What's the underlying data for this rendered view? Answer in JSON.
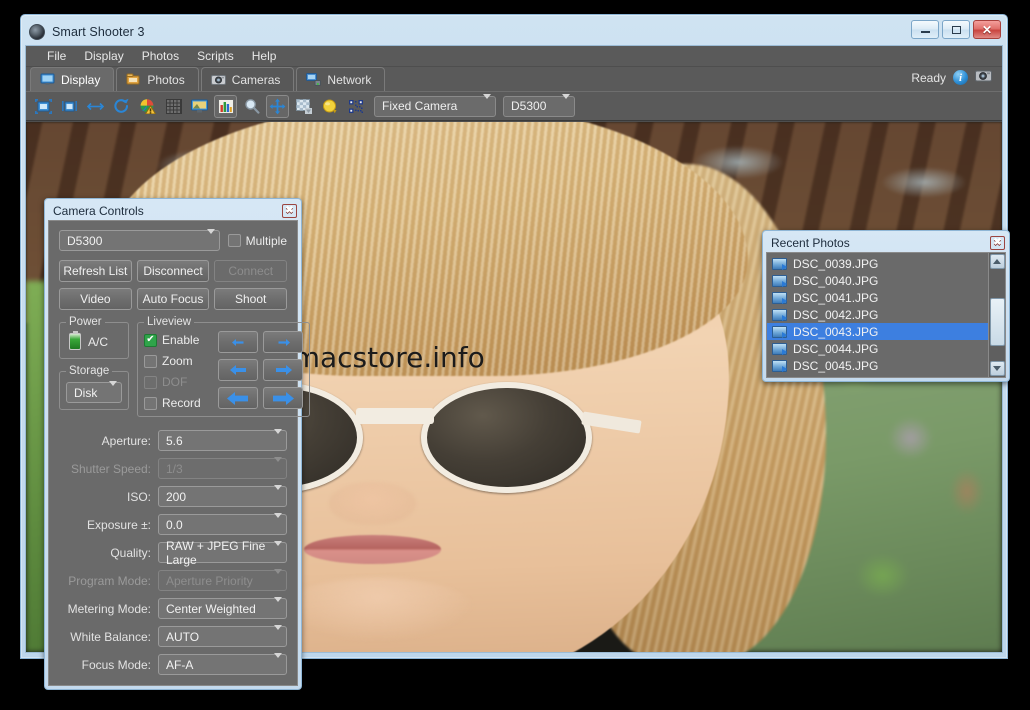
{
  "window": {
    "title": "Smart Shooter 3",
    "app_icon": "camera-lens-icon",
    "minimize_label": "Minimize",
    "maximize_label": "Maximize",
    "close_label": "Close"
  },
  "menubar": {
    "items": [
      {
        "label": "File"
      },
      {
        "label": "Display"
      },
      {
        "label": "Photos"
      },
      {
        "label": "Scripts"
      },
      {
        "label": "Help"
      }
    ]
  },
  "tabs": [
    {
      "label": "Display",
      "icon": "monitor-icon",
      "active": true
    },
    {
      "label": "Photos",
      "icon": "folder-image-icon",
      "active": false
    },
    {
      "label": "Cameras",
      "icon": "camera-icon",
      "active": false
    },
    {
      "label": "Network",
      "icon": "network-icon",
      "active": false
    }
  ],
  "status": {
    "text": "Ready",
    "info_icon": "info-icon",
    "info_glyph": "i",
    "camera_icon": "camera-status-icon"
  },
  "toolbar": {
    "buttons": [
      {
        "name": "fit-to-window-icon"
      },
      {
        "name": "actual-size-icon"
      },
      {
        "name": "fit-width-icon"
      },
      {
        "name": "refresh-icon"
      },
      {
        "name": "color-warning-icon"
      },
      {
        "name": "grid-icon"
      },
      {
        "name": "screen-overlay-icon"
      },
      {
        "name": "histogram-icon",
        "pressed": true
      },
      {
        "name": "magnifier-icon"
      },
      {
        "name": "move-tool-icon",
        "pressed": true
      },
      {
        "name": "transparency-icon"
      },
      {
        "name": "highlight-icon"
      },
      {
        "name": "qr-code-icon"
      }
    ],
    "camera_mode": {
      "value": "Fixed Camera",
      "caret": "chevron-down-icon"
    },
    "camera_model": {
      "value": "D5300",
      "caret": "chevron-down-icon"
    }
  },
  "viewport": {
    "watermark": "精品Mac软件尽在macstore.info"
  },
  "camera_controls": {
    "title": "Camera Controls",
    "close_glyph": "✖",
    "camera_select": {
      "value": "D5300"
    },
    "multiple": {
      "label": "Multiple",
      "checked": false
    },
    "buttons_row1": [
      {
        "label": "Refresh List",
        "disabled": false
      },
      {
        "label": "Disconnect",
        "disabled": false
      },
      {
        "label": "Connect",
        "disabled": true
      }
    ],
    "buttons_row2": [
      {
        "label": "Video",
        "disabled": false
      },
      {
        "label": "Auto Focus",
        "disabled": false
      },
      {
        "label": "Shoot",
        "disabled": false
      }
    ],
    "power": {
      "legend": "Power",
      "value": "A/C",
      "icon": "battery-icon"
    },
    "storage": {
      "legend": "Storage",
      "value": "Disk"
    },
    "liveview": {
      "legend": "Liveview",
      "checks": [
        {
          "label": "Enable",
          "checked": true,
          "disabled": false
        },
        {
          "label": "Zoom",
          "checked": false,
          "disabled": false
        },
        {
          "label": "DOF",
          "checked": false,
          "disabled": true
        },
        {
          "label": "Record",
          "checked": false,
          "disabled": false
        }
      ],
      "arrow_buttons": [
        {
          "name": "left-arrow-small",
          "dir": "left",
          "size": "small"
        },
        {
          "name": "right-arrow-small",
          "dir": "right",
          "size": "small"
        },
        {
          "name": "left-arrow-medium",
          "dir": "left",
          "size": "medium"
        },
        {
          "name": "right-arrow-medium",
          "dir": "right",
          "size": "medium"
        },
        {
          "name": "left-arrow-large",
          "dir": "left",
          "size": "large"
        },
        {
          "name": "right-arrow-large",
          "dir": "right",
          "size": "large"
        }
      ]
    },
    "params": [
      {
        "label": "Aperture:",
        "value": "5.6",
        "disabled": false
      },
      {
        "label": "Shutter Speed:",
        "value": "1/3",
        "disabled": true
      },
      {
        "label": "ISO:",
        "value": "200",
        "disabled": false
      },
      {
        "label": "Exposure ±:",
        "value": "0.0",
        "disabled": false
      },
      {
        "label": "Quality:",
        "value": "RAW + JPEG Fine Large",
        "disabled": false
      },
      {
        "label": "Program Mode:",
        "value": "Aperture Priority",
        "disabled": true
      },
      {
        "label": "Metering Mode:",
        "value": "Center Weighted",
        "disabled": false
      },
      {
        "label": "White Balance:",
        "value": "AUTO",
        "disabled": false
      },
      {
        "label": "Focus Mode:",
        "value": "AF-A",
        "disabled": false
      }
    ]
  },
  "recent_photos": {
    "title": "Recent Photos",
    "close_glyph": "✖",
    "items": [
      {
        "name": "DSC_0039.JPG",
        "selected": false
      },
      {
        "name": "DSC_0040.JPG",
        "selected": false
      },
      {
        "name": "DSC_0041.JPG",
        "selected": false
      },
      {
        "name": "DSC_0042.JPG",
        "selected": false
      },
      {
        "name": "DSC_0043.JPG",
        "selected": true
      },
      {
        "name": "DSC_0044.JPG",
        "selected": false
      },
      {
        "name": "DSC_0045.JPG",
        "selected": false
      }
    ],
    "scrollbar": {
      "up": "scroll-up-arrow",
      "down": "scroll-down-arrow"
    }
  },
  "colors": {
    "window_frame": "#c4daee",
    "client_bg": "#5a5a5a",
    "panel_bg": "#6a6a6a",
    "selection_blue": "#3d7fe0",
    "accent_check_green": "#2fa44a",
    "arrow_blue": "#3a90e8"
  }
}
